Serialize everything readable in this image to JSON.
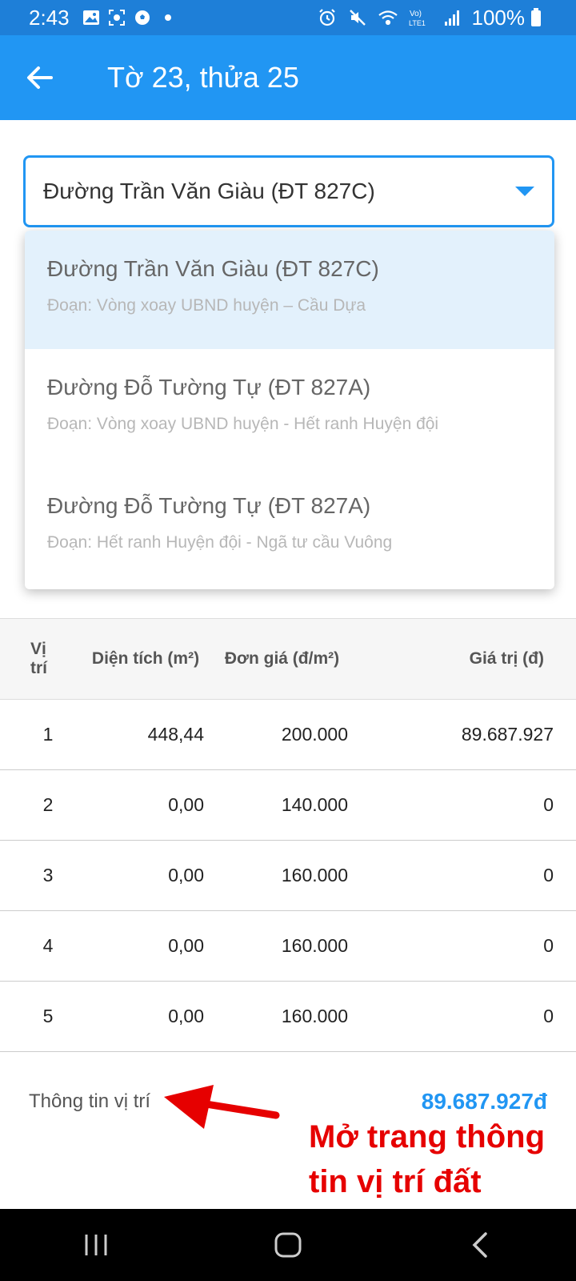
{
  "status_bar": {
    "time": "2:43",
    "battery": "100%",
    "net_label": "LTE1"
  },
  "app_bar": {
    "title": "Tờ 23, thửa 25"
  },
  "road_select": {
    "selected": "Đường Trần Văn Giàu (ĐT 827C)"
  },
  "dropdown": {
    "options": [
      {
        "title": "Đường Trần Văn Giàu (ĐT 827C)",
        "segment": "Đoạn: Vòng xoay UBND huyện – Cầu Dựa",
        "selected": true
      },
      {
        "title": "Đường Đỗ Tường Tự (ĐT 827A)",
        "segment": "Đoạn: Vòng xoay UBND huyện - Hết ranh Huyện đội",
        "selected": false
      },
      {
        "title": "Đường Đỗ Tường Tự (ĐT 827A)",
        "segment": "Đoạn: Hết ranh Huyện đội - Ngã tư cầu Vuông",
        "selected": false
      }
    ]
  },
  "table": {
    "headers": [
      "Vị trí",
      "Diện tích (m²)",
      "Đơn giá (đ/m²)",
      "Giá trị (đ)"
    ],
    "rows": [
      [
        "1",
        "448,44",
        "200.000",
        "89.687.927"
      ],
      [
        "2",
        "0,00",
        "140.000",
        "0"
      ],
      [
        "3",
        "0,00",
        "160.000",
        "0"
      ],
      [
        "4",
        "0,00",
        "160.000",
        "0"
      ],
      [
        "5",
        "0,00",
        "160.000",
        "0"
      ]
    ]
  },
  "footer": {
    "info_link": "Thông tin vị trí",
    "total": "89.687.927đ"
  },
  "annotation": {
    "text": "Mở trang thông tin vị trí đất"
  },
  "colors": {
    "primary": "#2196F3",
    "status_bar": "#1E7FD8",
    "selected_option": "#E3F1FC",
    "annotation": "#e60000"
  }
}
